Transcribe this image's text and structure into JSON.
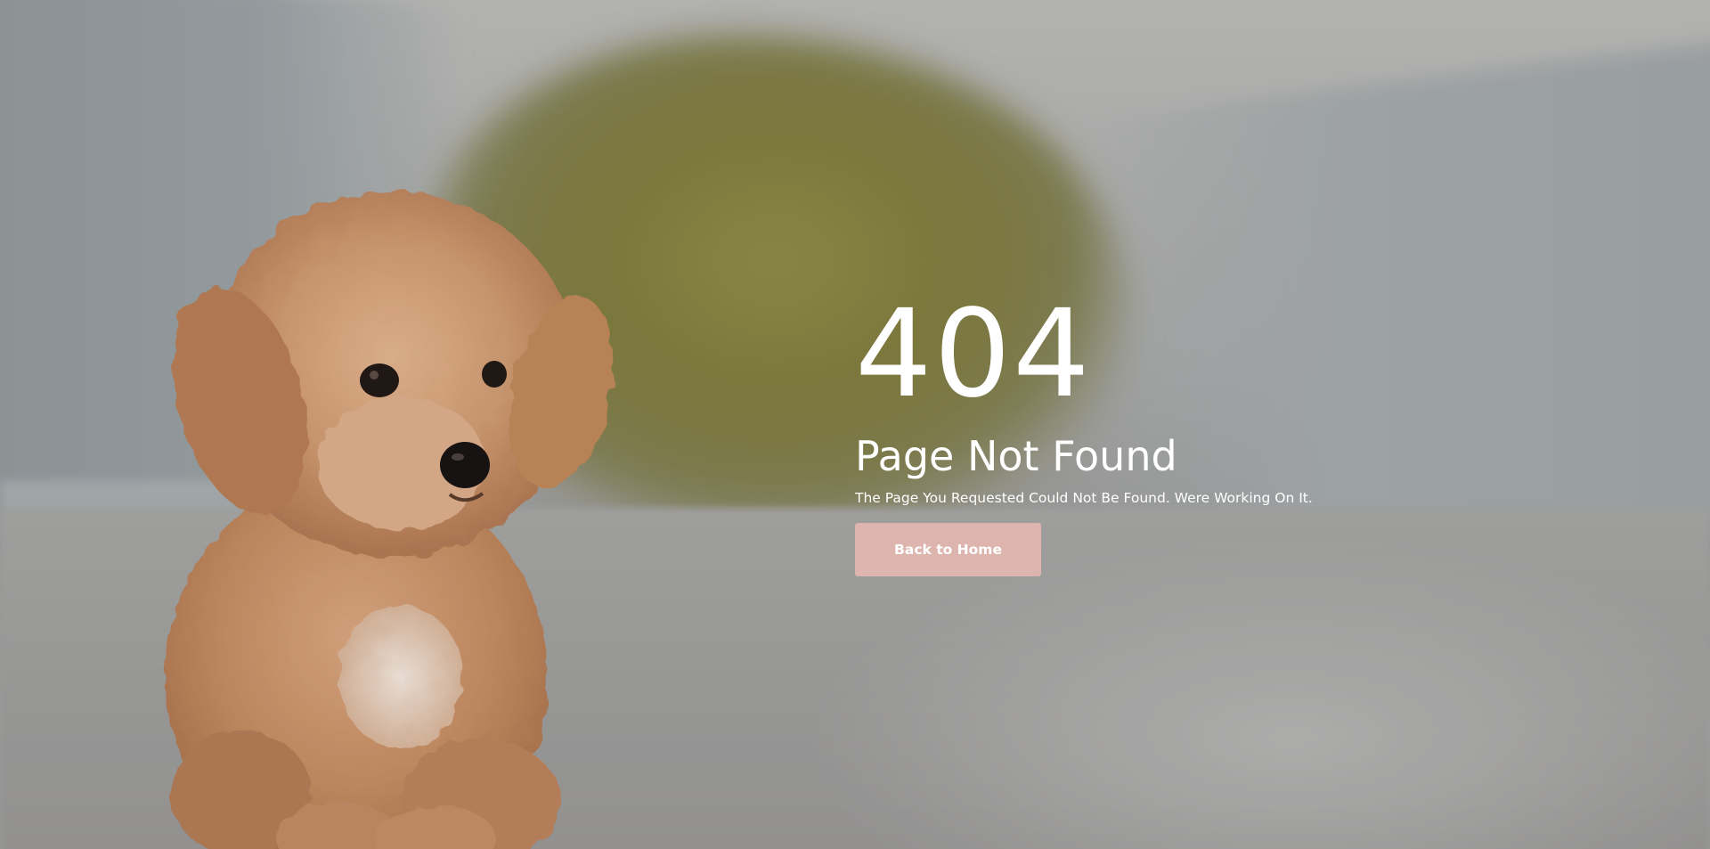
{
  "error": {
    "code": "404",
    "title": "Page Not Found",
    "message": "The Page You Requested Could Not Be Found. Were Working On It.",
    "button_label": "Back to Home"
  },
  "colors": {
    "button_background": "#ddb5ae",
    "text": "#ffffff"
  }
}
